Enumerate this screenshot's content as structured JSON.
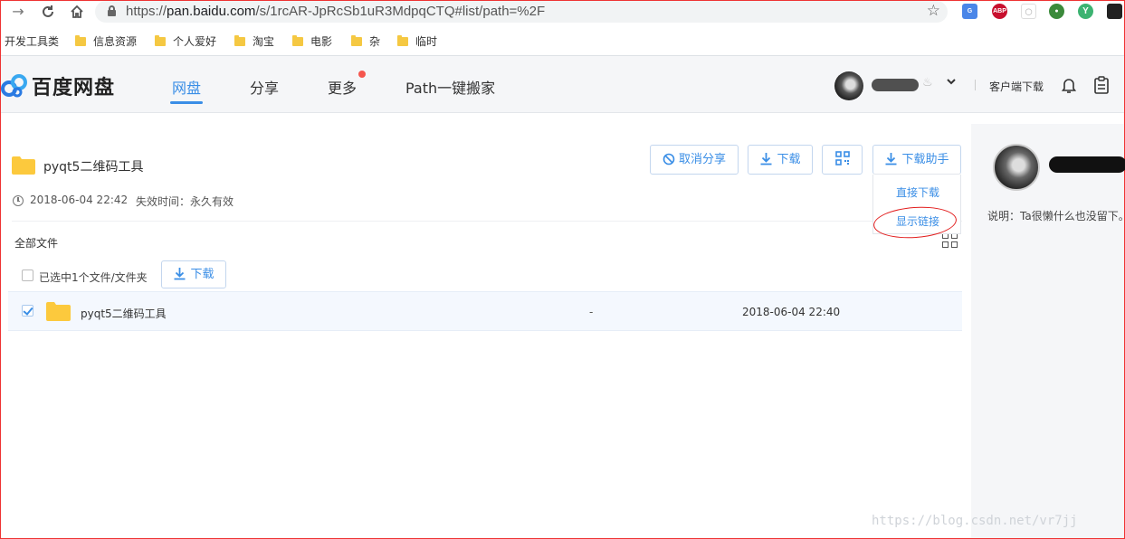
{
  "browser": {
    "url_scheme": "https://",
    "url_host": "pan.baidu.com",
    "url_path": "/s/1rcAR-JpRcSb1uR3MdpqCTQ#list/path=%2F",
    "bookmarks": [
      "开发工具类",
      "信息资源",
      "个人爱好",
      "淘宝",
      "电影",
      "杂",
      "临时"
    ],
    "extensions": [
      "ABP"
    ]
  },
  "header": {
    "logo_text": "百度网盘",
    "nav": [
      "网盘",
      "分享",
      "更多",
      "Path一键搬家"
    ],
    "client_download": "客户端下载"
  },
  "share": {
    "title": "pyqt5二维码工具",
    "created": "2018-06-04 22:42",
    "expire": "失效时间：永久有效",
    "buttons": {
      "cancel_share": "取消分享",
      "download": "下载",
      "download_helper": "下载助手"
    },
    "dropdown": [
      "直接下载",
      "显示链接"
    ]
  },
  "filelist": {
    "breadcrumb": "全部文件",
    "selection": "已选中1个文件/文件夹",
    "download": "下载",
    "rows": [
      {
        "name": "pyqt5二维码工具",
        "size": "-",
        "date": "2018-06-04 22:40",
        "checked": true
      }
    ]
  },
  "sidebar": {
    "desc": "说明：Ta很懒什么也没留下。"
  },
  "watermark": "https://blog.csdn.net/vr7jj",
  "colors": {
    "accent": "#3a8ee6",
    "annotation": "#e21d1d",
    "folder": "#fcc93d"
  }
}
